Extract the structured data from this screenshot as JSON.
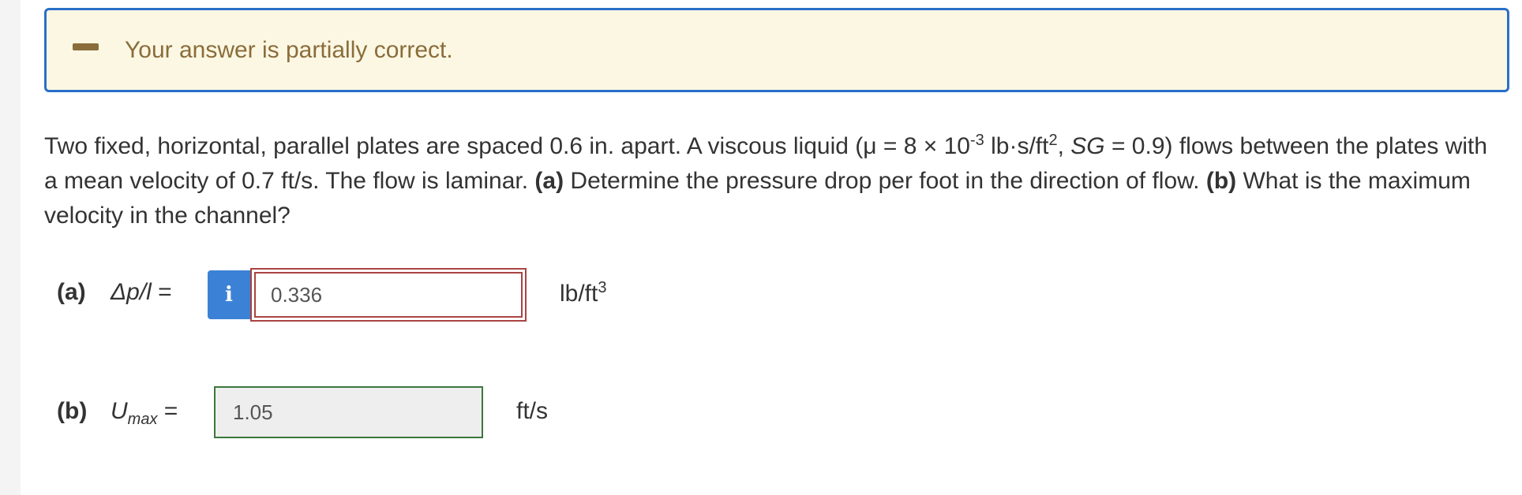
{
  "feedback": {
    "message": "Your answer is partially correct.",
    "icon": "minus-icon",
    "background": "#fbf7e3",
    "border_color": "#2a6fc9",
    "text_color": "#8a6d3b"
  },
  "question": {
    "text_1": "Two fixed, horizontal, parallel plates are spaced 0.6 in. apart. A viscous liquid (μ = 8 × 10",
    "mu_exponent": "-3",
    "text_2": " lb·s/ft",
    "text_2_exp": "2",
    "text_3": ", ",
    "sg_symbol": "SG",
    "text_4": " = 0.9) flows between the plates with a mean velocity of 0.7 ft/s. The flow is laminar. ",
    "part_a_marker": "(a)",
    "text_5": " Determine the pressure drop per foot in the direction of flow. ",
    "part_b_marker": "(b)",
    "text_6": " What is the maximum velocity in the channel?"
  },
  "part_a": {
    "label": "(a)",
    "symbol": "Δp/l",
    "equals": " =",
    "info_icon": "info-icon",
    "info_glyph": "i",
    "value": "0.336",
    "status": "incorrect",
    "unit_base": "lb/ft",
    "unit_exp": "3"
  },
  "part_b": {
    "label": "(b)",
    "symbol": "U",
    "symbol_sub": "max",
    "equals": " =",
    "value": "1.05",
    "status": "correct",
    "unit": "ft/s"
  }
}
